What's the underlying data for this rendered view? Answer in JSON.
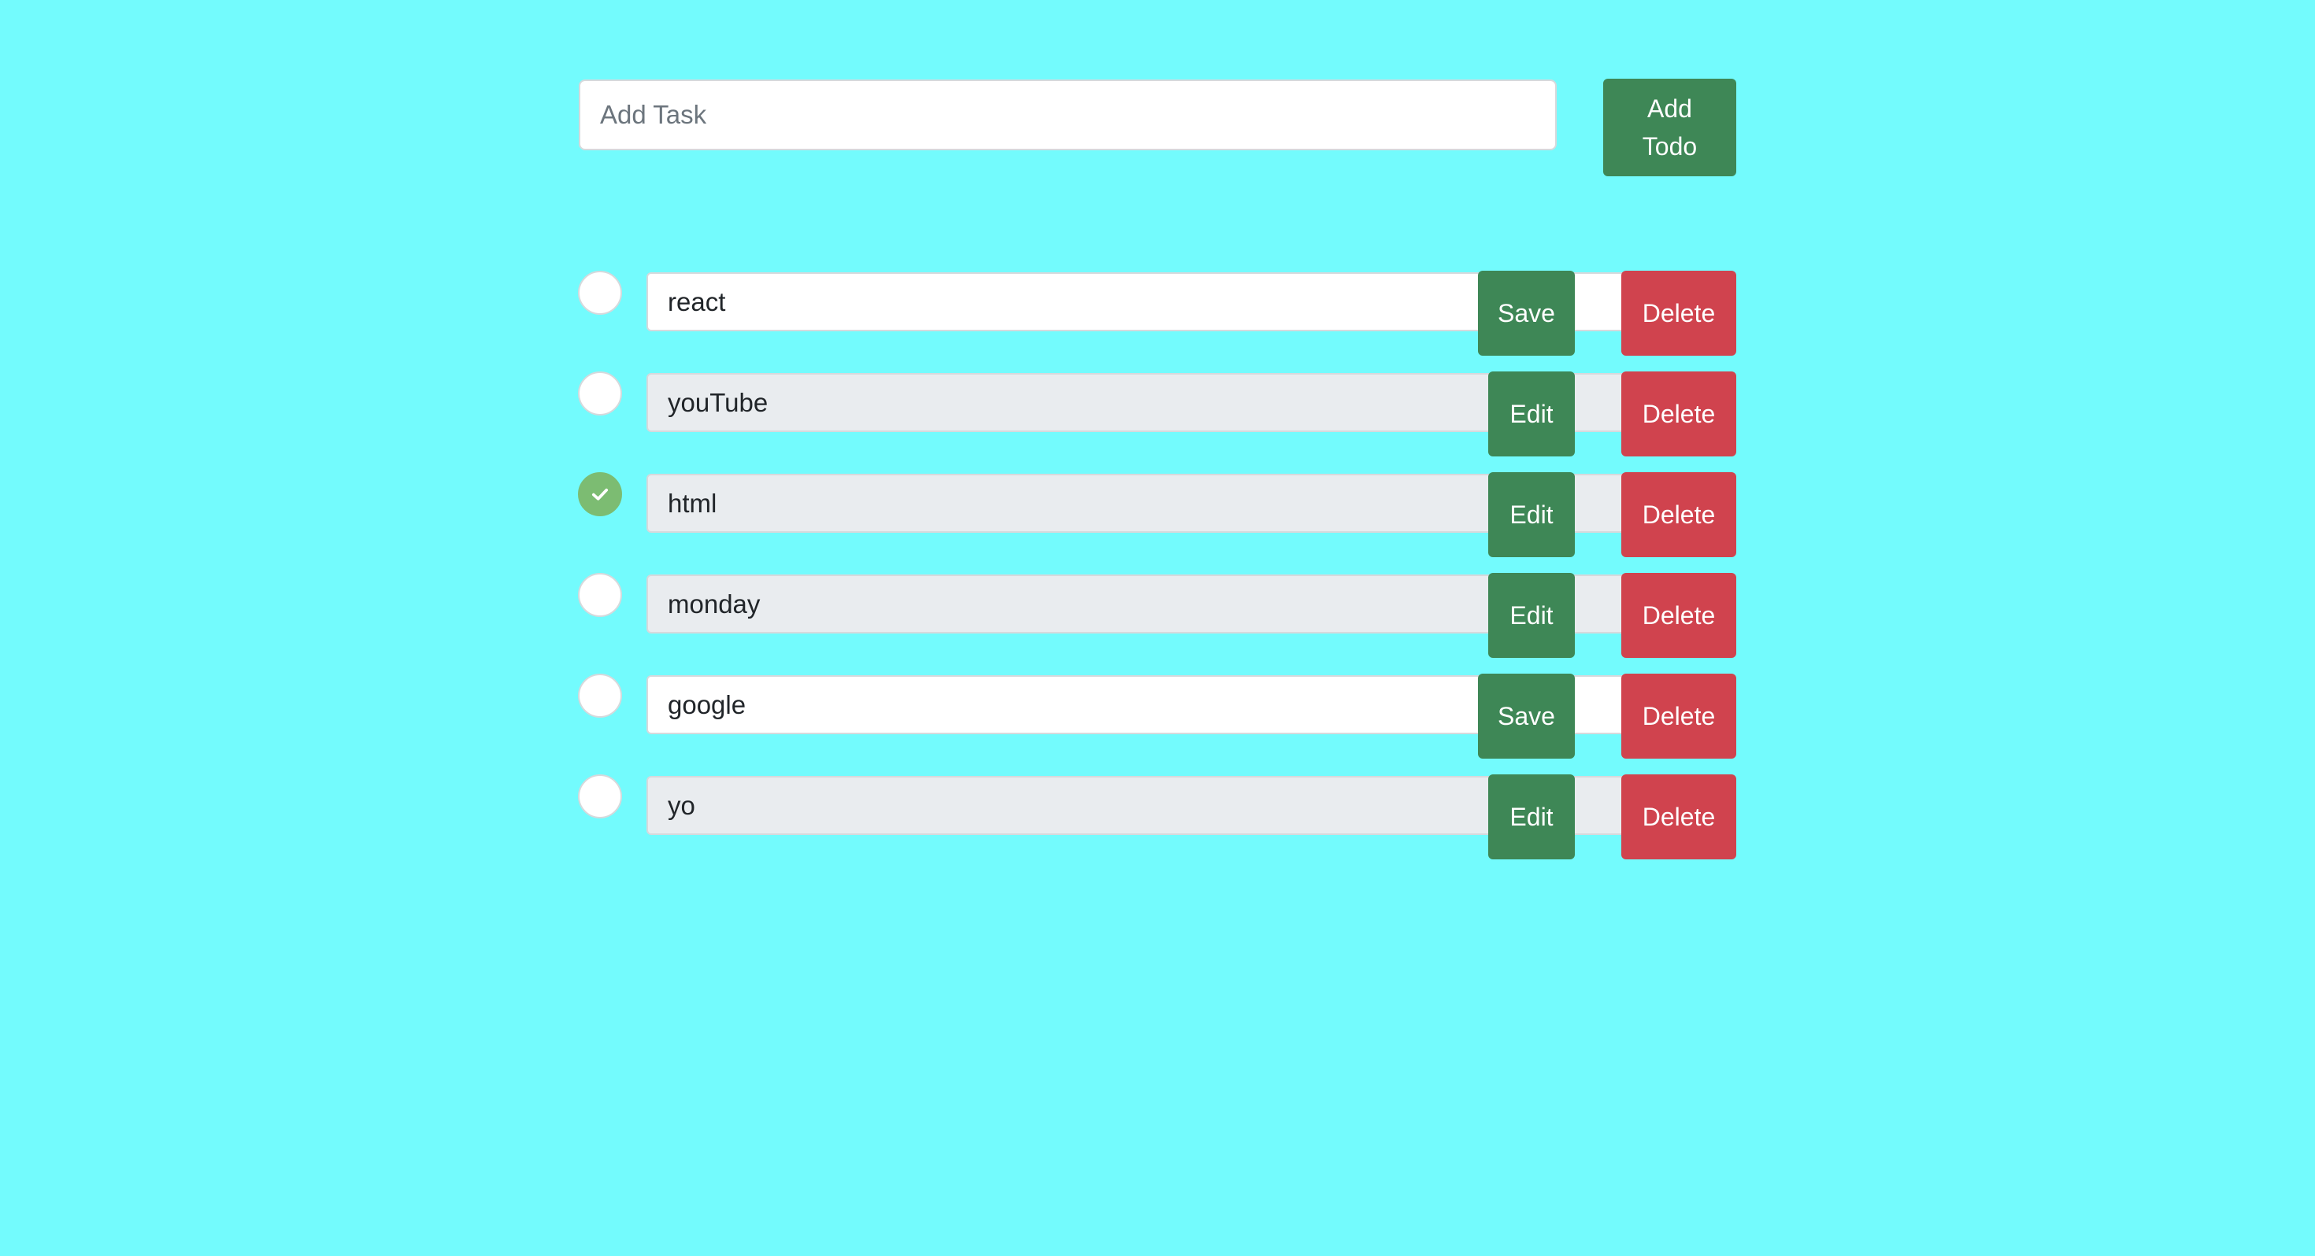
{
  "add_task": {
    "placeholder": "Add Task",
    "button_label": "Add Todo"
  },
  "todos": [
    {
      "text": "react",
      "completed": false,
      "mode": "editing",
      "action_label": "Save",
      "delete_label": "Delete"
    },
    {
      "text": "youTube",
      "completed": false,
      "mode": "view",
      "action_label": "Edit",
      "delete_label": "Delete"
    },
    {
      "text": "html",
      "completed": true,
      "mode": "view",
      "action_label": "Edit",
      "delete_label": "Delete"
    },
    {
      "text": "monday",
      "completed": false,
      "mode": "view",
      "action_label": "Edit",
      "delete_label": "Delete"
    },
    {
      "text": "google",
      "completed": false,
      "mode": "editing",
      "action_label": "Save",
      "delete_label": "Delete"
    },
    {
      "text": "yo",
      "completed": false,
      "mode": "view",
      "action_label": "Edit",
      "delete_label": "Delete"
    }
  ],
  "colors": {
    "background": "#73FBFD",
    "primary_green": "#3E8756",
    "danger_red": "#D0434E",
    "check_green": "#7CBC72",
    "readonly_input": "#E9ECEF"
  },
  "icons": {
    "completed_check": "check-icon"
  }
}
